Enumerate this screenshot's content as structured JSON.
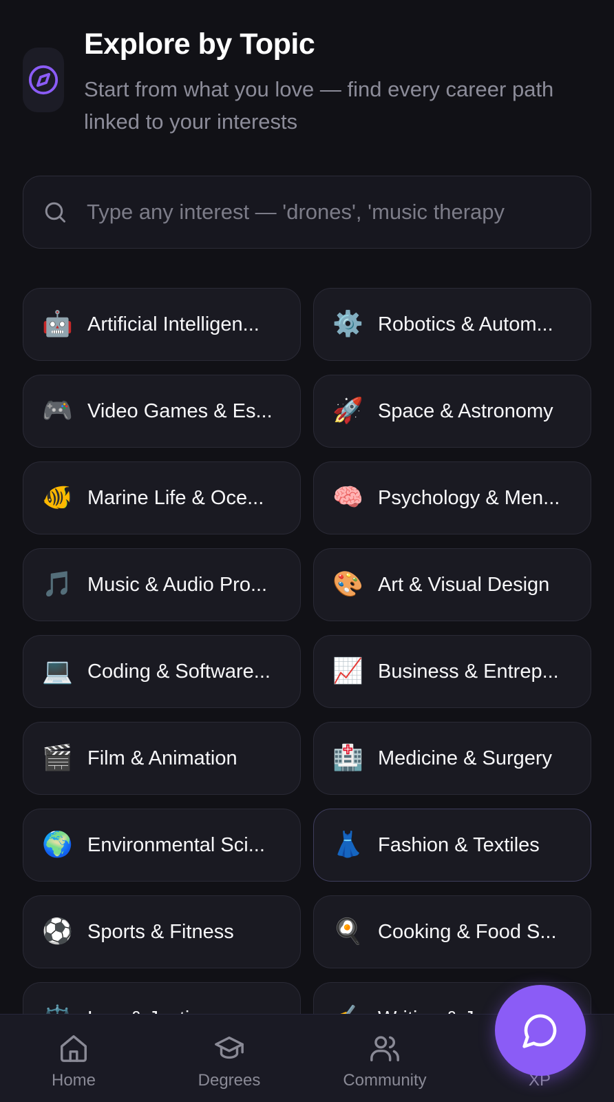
{
  "header": {
    "title": "Explore by Topic",
    "subtitle": "Start from what you love — find every career path linked to your interests",
    "icon": "compass-icon",
    "accent_color": "#8b5cf6"
  },
  "search": {
    "placeholder": "Type any interest — 'drones', 'music therapy",
    "value": ""
  },
  "topics": [
    {
      "emoji": "🤖",
      "label": "Artificial Intelligen..."
    },
    {
      "emoji": "⚙️",
      "label": "Robotics & Autom..."
    },
    {
      "emoji": "🎮",
      "label": "Video Games & Es..."
    },
    {
      "emoji": "🚀",
      "label": "Space & Astronomy"
    },
    {
      "emoji": "🐠",
      "label": "Marine Life & Oce..."
    },
    {
      "emoji": "🧠",
      "label": "Psychology & Men..."
    },
    {
      "emoji": "🎵",
      "label": "Music & Audio Pro..."
    },
    {
      "emoji": "🎨",
      "label": "Art & Visual Design"
    },
    {
      "emoji": "💻",
      "label": "Coding & Software..."
    },
    {
      "emoji": "📈",
      "label": "Business & Entrep..."
    },
    {
      "emoji": "🎬",
      "label": "Film & Animation"
    },
    {
      "emoji": "🏥",
      "label": "Medicine & Surgery"
    },
    {
      "emoji": "🌍",
      "label": "Environmental Sci..."
    },
    {
      "emoji": "👗",
      "label": "Fashion & Textiles"
    },
    {
      "emoji": "⚽",
      "label": "Sports & Fitness"
    },
    {
      "emoji": "🍳",
      "label": "Cooking & Food S..."
    },
    {
      "emoji": "⚖️",
      "label": "Law & Justice"
    },
    {
      "emoji": "✍️",
      "label": "Writing & Jo..."
    }
  ],
  "nav": {
    "items": [
      {
        "label": "Home",
        "icon": "home-icon"
      },
      {
        "label": "Degrees",
        "icon": "graduation-cap-icon"
      },
      {
        "label": "Community",
        "icon": "users-icon"
      },
      {
        "label": "XP",
        "icon": "xp-icon"
      }
    ]
  },
  "fab": {
    "icon": "chat-bubble-icon",
    "color": "#8b5cf6"
  }
}
